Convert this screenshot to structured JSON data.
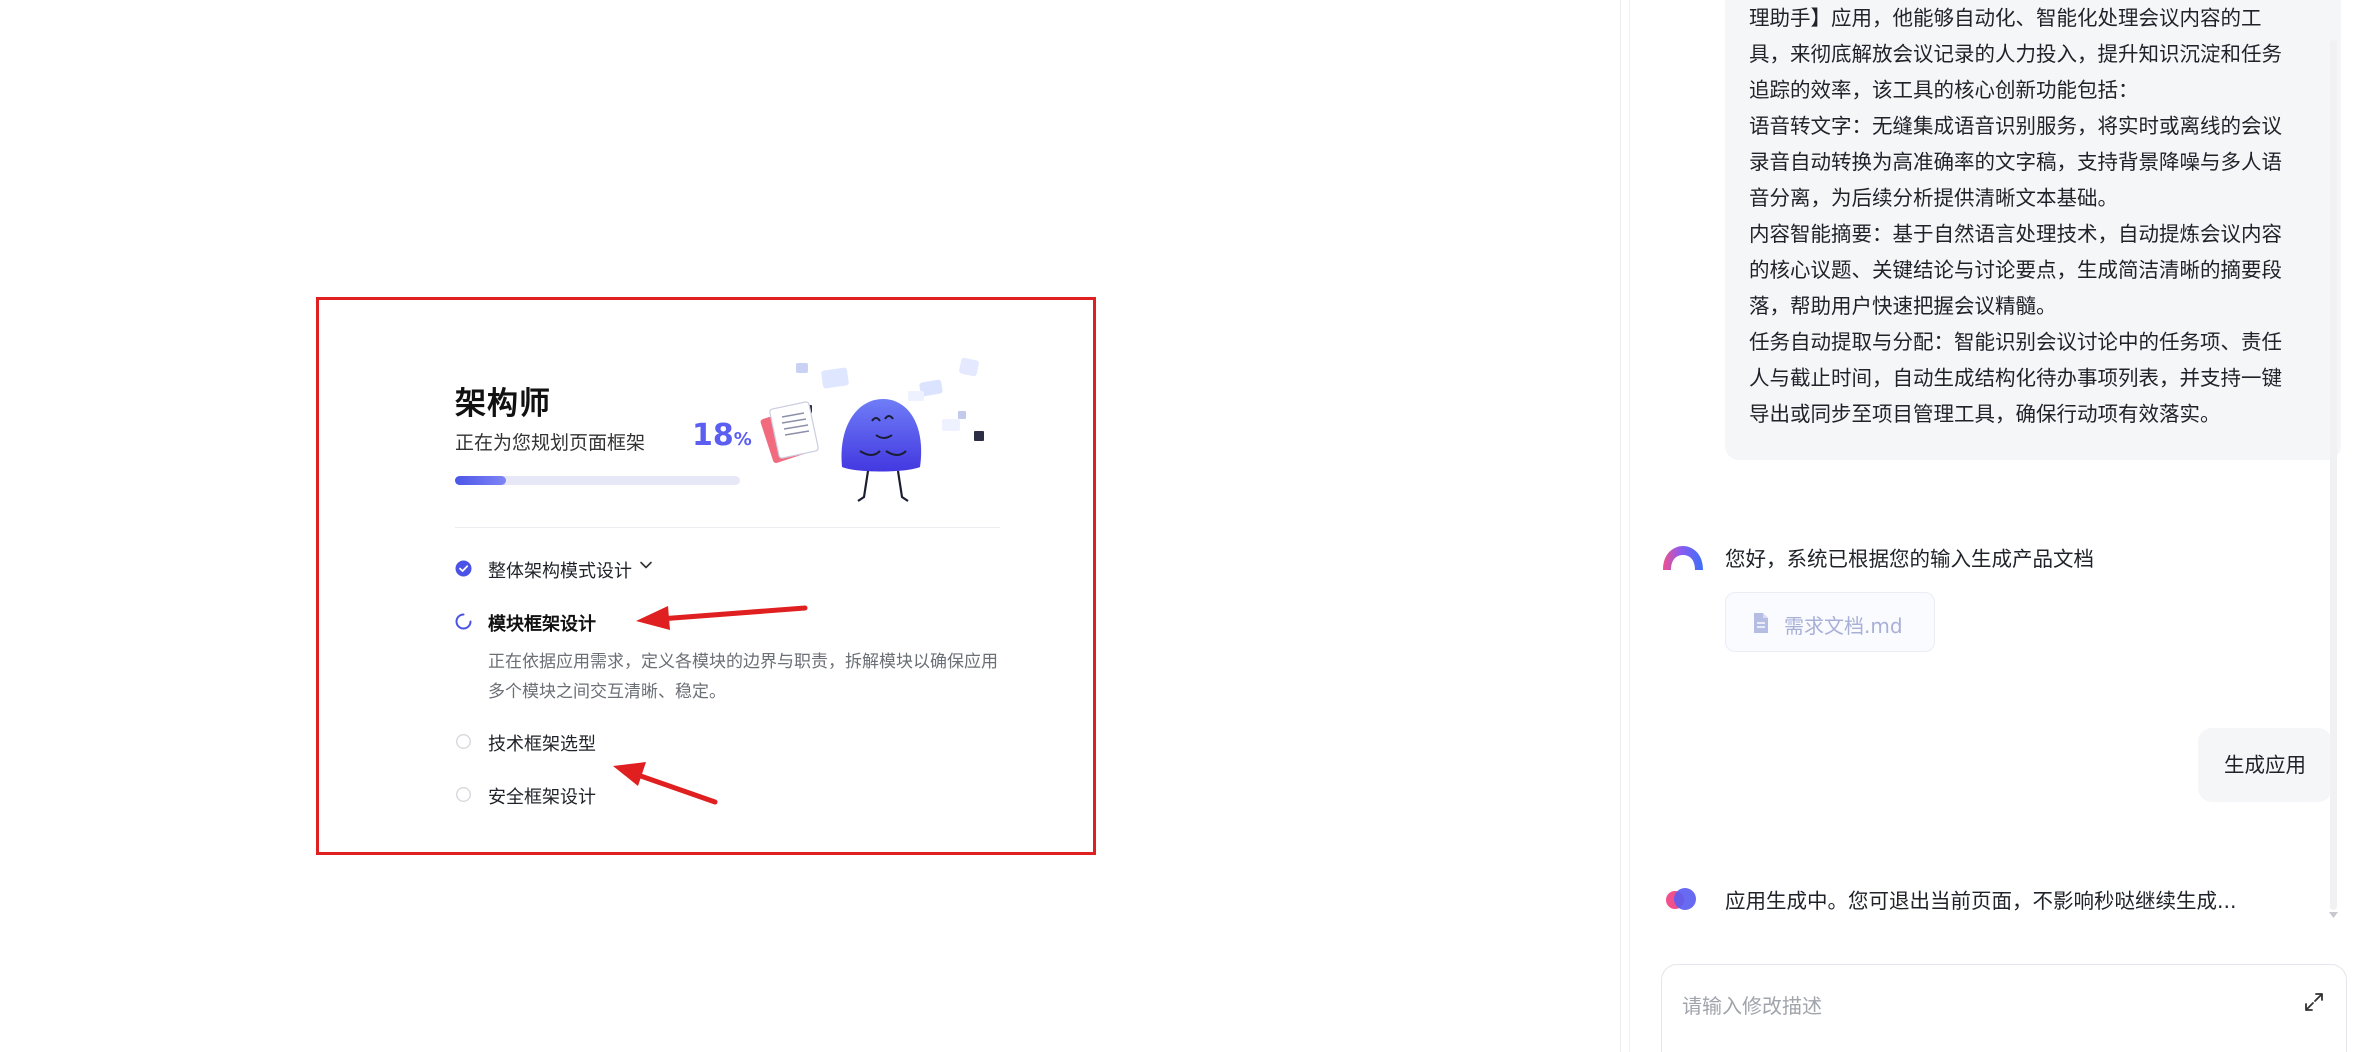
{
  "progress_card": {
    "title": "架构师",
    "subtitle": "正在为您规划页面框架",
    "percent_value": "18",
    "percent_sign": "%",
    "progress_fraction": 0.18,
    "accent_color": "#5b5ef0",
    "steps": [
      {
        "label": "整体架构模式设计",
        "status": "done",
        "has_chevron": true
      },
      {
        "label": "模块框架设计",
        "status": "in-progress",
        "description": "正在依据应用需求，定义各模块的边界与职责，拆解模块以确保应用多个模块之间交互清晰、稳定。"
      },
      {
        "label": "技术框架选型",
        "status": "pending"
      },
      {
        "label": "安全框架设计",
        "status": "pending"
      }
    ]
  },
  "annotation": {
    "box_color": "#e02020",
    "arrow_color": "#e02020"
  },
  "chat": {
    "doc_bubble_lines": [
      "理助手】应用，他能够自动化、智能化处理会议内容的工",
      "具，来彻底解放会议记录的人力投入，提升知识沉淀和任务",
      "追踪的效率，该工具的核心创新功能包括：",
      "语音转文字：无缝集成语音识别服务，将实时或离线的会议",
      "录音自动转换为高准确率的文字稿，支持背景降噪与多人语",
      "音分离，为后续分析提供清晰文本基础。",
      "内容智能摘要：基于自然语言处理技术，自动提炼会议内容",
      "的核心议题、关键结论与讨论要点，生成简洁清晰的摘要段",
      "落，帮助用户快速把握会议精髓。",
      "任务自动提取与分配：智能识别会议讨论中的任务项、责任",
      "人与截止时间，自动生成结构化待办事项列表，并支持一键",
      "导出或同步至项目管理工具，确保行动项有效落实。"
    ],
    "bot_message_1": "您好，系统已根据您的输入生成产品文档",
    "file_name": "需求文档.md",
    "user_message": "生成应用",
    "bot_message_2": "应用生成中。您可退出当前页面，不影响秒哒继续生成...",
    "input_placeholder": "请输入修改描述",
    "input_value": ""
  }
}
